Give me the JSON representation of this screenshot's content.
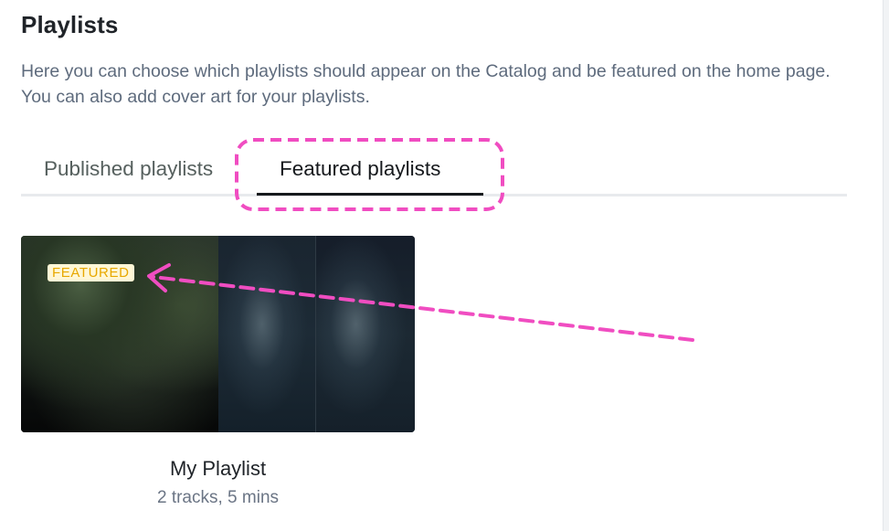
{
  "header": {
    "title": "Playlists",
    "description": "Here you can choose which playlists should appear on the Catalog and be featured on the home page. You can also add cover art for your playlists."
  },
  "tabs": [
    {
      "label": "Published playlists",
      "active": false
    },
    {
      "label": "Featured playlists",
      "active": true
    }
  ],
  "playlists": [
    {
      "name": "My Playlist",
      "meta": "2 tracks, 5 mins",
      "badge": "FEATURED"
    }
  ],
  "colors": {
    "annotation": "#f04dc1",
    "badge_text": "#e8a800",
    "badge_bg": "#fff7d6"
  }
}
